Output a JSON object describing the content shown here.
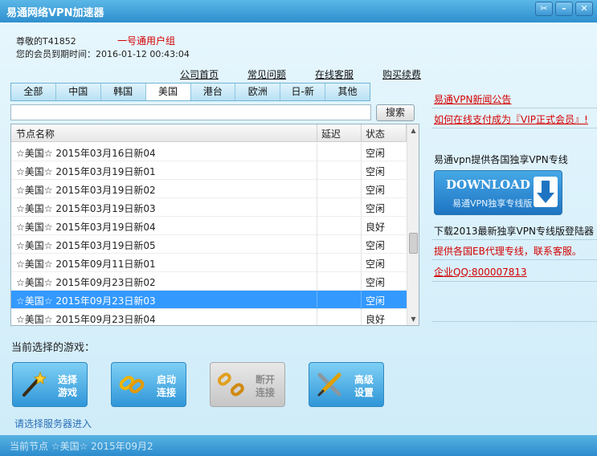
{
  "window": {
    "title": "易通网络VPN加速器",
    "controls": [
      "tools-icon",
      "minimize-icon",
      "close-icon"
    ]
  },
  "user": {
    "greeting": "尊敬的T41852",
    "group": "一号通用户组",
    "expiry_label": "您的会员到期时间：2016-01-12 00:43:04"
  },
  "top_links": [
    "公司首页",
    "常见问题",
    "在线客服",
    "购买续费"
  ],
  "region_tabs": {
    "items": [
      "全部",
      "中国",
      "韩国",
      "美国",
      "港台",
      "欧洲",
      "日-新",
      "其他"
    ],
    "active": "美国"
  },
  "search": {
    "value": "",
    "button": "搜索"
  },
  "node_list": {
    "headers": [
      "节点名称",
      "延迟",
      "状态"
    ],
    "rows": [
      {
        "name": "☆美国☆ 2015年03月16日新04",
        "latency": "",
        "status": "空闲",
        "selected": false
      },
      {
        "name": "☆美国☆ 2015年03月19日新01",
        "latency": "",
        "status": "空闲",
        "selected": false
      },
      {
        "name": "☆美国☆ 2015年03月19日新02",
        "latency": "",
        "status": "空闲",
        "selected": false
      },
      {
        "name": "☆美国☆ 2015年03月19日新03",
        "latency": "",
        "status": "空闲",
        "selected": false
      },
      {
        "name": "☆美国☆ 2015年03月19日新04",
        "latency": "",
        "status": "良好",
        "selected": false
      },
      {
        "name": "☆美国☆ 2015年03月19日新05",
        "latency": "",
        "status": "空闲",
        "selected": false
      },
      {
        "name": "☆美国☆ 2015年09月11日新01",
        "latency": "",
        "status": "空闲",
        "selected": false
      },
      {
        "name": "☆美国☆ 2015年09月23日新02",
        "latency": "",
        "status": "空闲",
        "selected": false
      },
      {
        "name": "☆美国☆ 2015年09月23日新03",
        "latency": "",
        "status": "空闲",
        "selected": true
      },
      {
        "name": "☆美国☆ 2015年09月23日新04",
        "latency": "",
        "status": "良好",
        "selected": false
      }
    ]
  },
  "current_game_label": "当前选择的游戏：",
  "action_buttons": [
    {
      "label_1": "选择",
      "label_2": "游戏",
      "icon": "wand-icon",
      "enabled": true
    },
    {
      "label_1": "启动",
      "label_2": "连接",
      "icon": "chain-link-icon",
      "enabled": true
    },
    {
      "label_1": "断开",
      "label_2": "连接",
      "icon": "broken-chain-icon",
      "enabled": false
    },
    {
      "label_1": "高级",
      "label_2": "设置",
      "icon": "wrench-screwdriver-icon",
      "enabled": true
    }
  ],
  "hint": "请选择服务器进入",
  "status_bar": "当前节点 ☆美国☆ 2015年09月2",
  "sidebar": {
    "news_link": "易通VPN新闻公告",
    "vip_link": "如何在线支付成为『VIP正式会员』!",
    "exclusive_line_text": "易通vpn提供各国独享VPN专线",
    "download_banner_title": "DOWNLOAD",
    "download_banner_subtitle": "易通VPN独享专线版",
    "download_text": "下载2013最新独享VPN专线版登陆器",
    "agent_text": "提供各国EB代理专线，联系客服。",
    "qq_link": "企业QQ:800007813"
  },
  "colors": {
    "titlebar": "#2f8fcf",
    "selected_row": "#3399ff",
    "link_red": "#d40000",
    "hint_blue": "#2a6fb7"
  }
}
